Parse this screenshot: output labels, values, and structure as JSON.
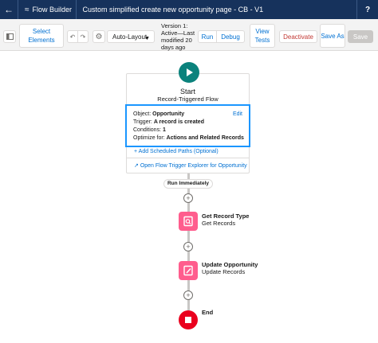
{
  "header": {
    "back_icon": "back-arrow-icon",
    "app_title": "Flow Builder",
    "page_title": "Custom simplified create new opportunity page - CB - V1",
    "help_label": "?"
  },
  "toolbar": {
    "select_elements": "Select Elements",
    "layout_value": "Auto-Layout",
    "version_text": "Version 1: Active—Last modified 20 days ago",
    "run": "Run",
    "debug": "Debug",
    "view_tests": "View Tests",
    "deactivate": "Deactivate",
    "save_as": "Save As",
    "save": "Save"
  },
  "start": {
    "title": "Start",
    "subtitle": "Record-Triggered Flow",
    "edit": "Edit",
    "object_label": "Object:",
    "object_value": "Opportunity",
    "trigger_label": "Trigger:",
    "trigger_value": "A record is created",
    "conditions_label": "Conditions:",
    "conditions_value": "1",
    "optimize_label": "Optimize for:",
    "optimize_value": "Actions and Related Records",
    "add_paths": "Add Scheduled Paths (Optional)",
    "open_explorer": "Open Flow Trigger Explorer for Opportunity"
  },
  "run_label": "Run Immediately",
  "nodes": [
    {
      "title": "Get Record Type",
      "subtitle": "Get Records",
      "icon": "get-records-icon"
    },
    {
      "title": "Update Opportunity",
      "subtitle": "Update Records",
      "icon": "update-records-icon"
    }
  ],
  "end_label": "End",
  "colors": {
    "header_bg": "#16325c",
    "start_green": "#0b827c",
    "node_pink": "#ff5d8d",
    "end_red": "#ea001e",
    "link_blue": "#0070d2",
    "focus_blue": "#1b96ff"
  }
}
